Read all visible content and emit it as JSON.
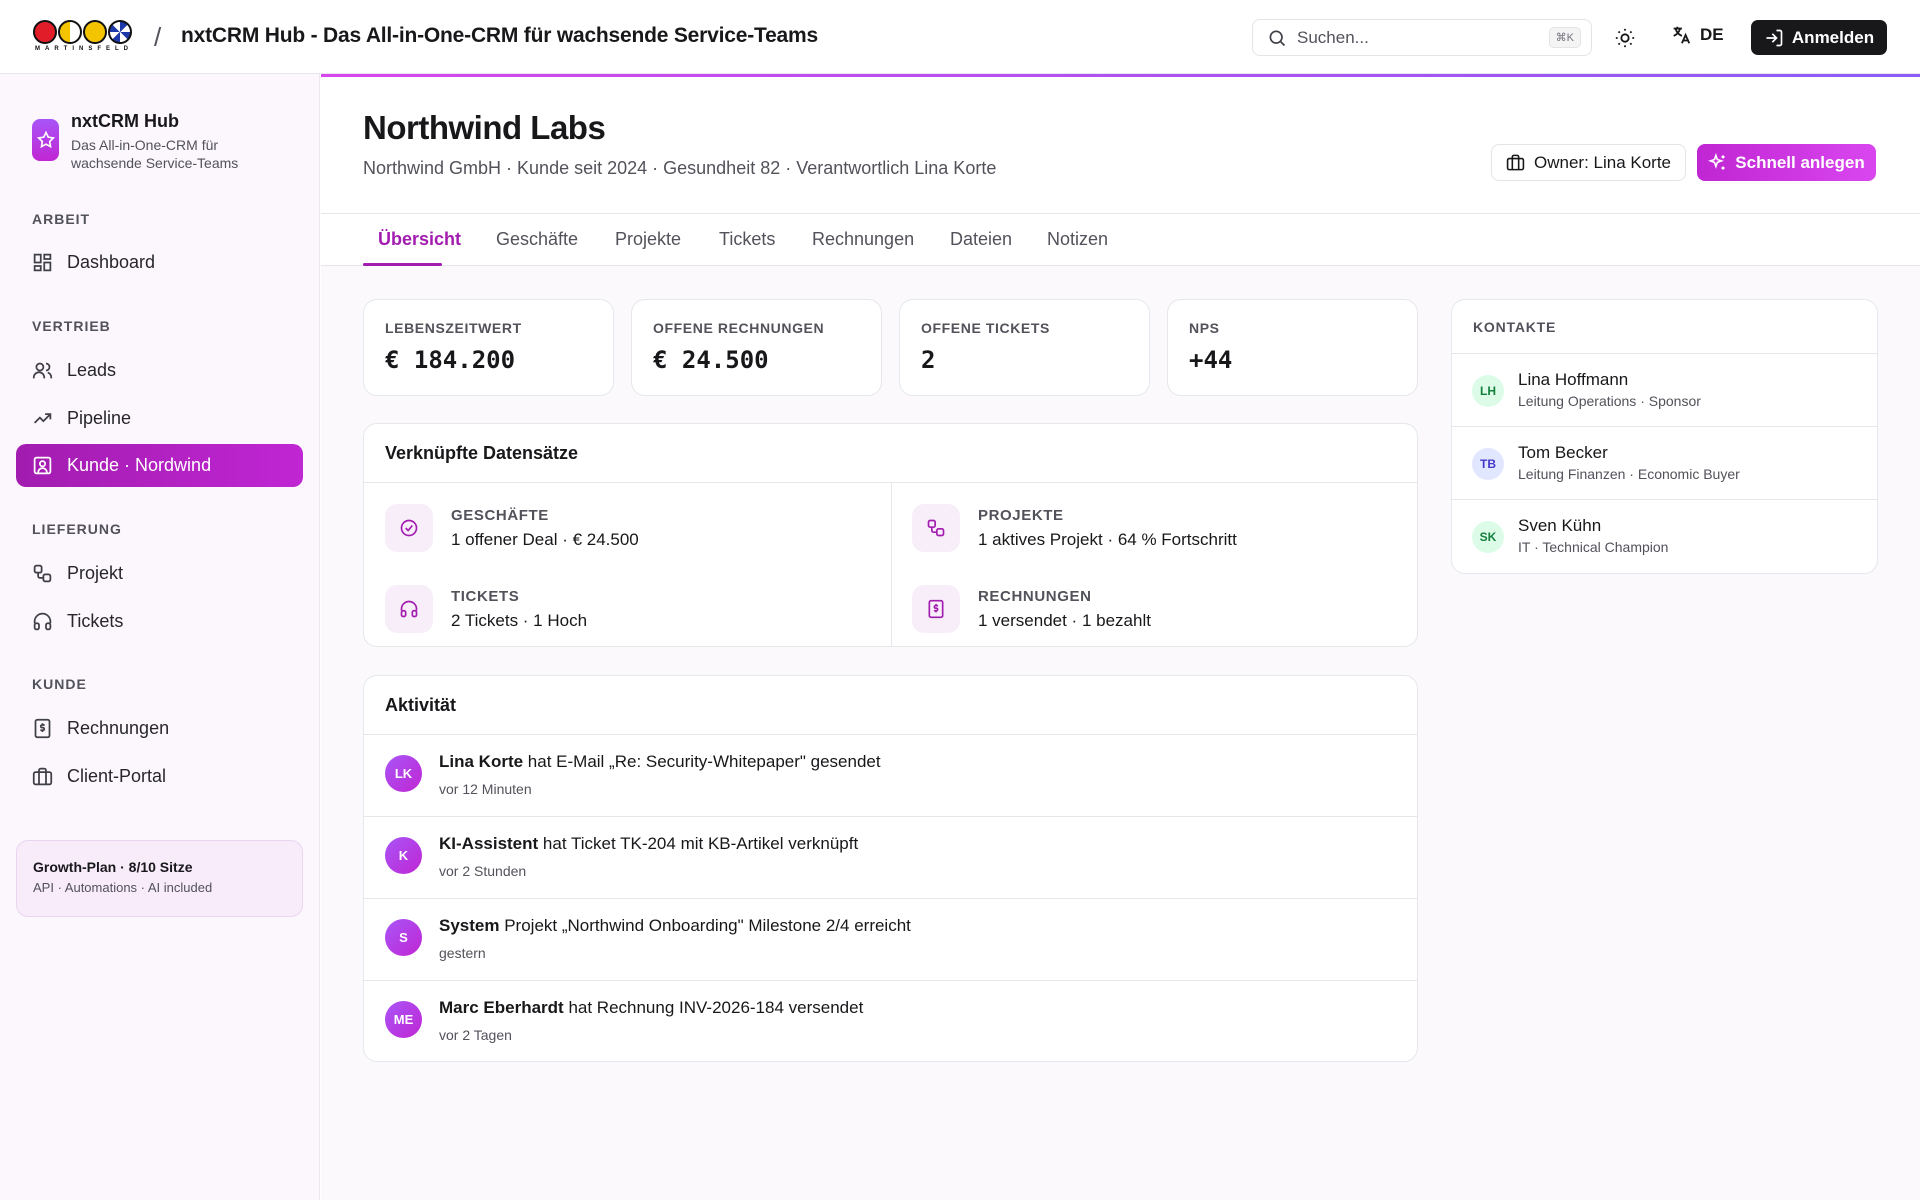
{
  "topbar": {
    "logo_text": "MARTINSFELD",
    "title": "nxtCRM Hub - Das All-in-One-CRM für wachsende Service-Teams",
    "search_placeholder": "Suchen...",
    "search_shortcut": "⌘K",
    "language": "DE",
    "login_label": "Anmelden",
    "icons": [
      "search-icon",
      "sun-icon",
      "translate-icon",
      "login-icon"
    ]
  },
  "sidebar": {
    "brand_name": "nxtCRM Hub",
    "brand_sub": "Das All-in-One-CRM für wachsende Service-Teams",
    "sections": [
      {
        "title": "ARBEIT",
        "items": [
          {
            "label": "Dashboard",
            "icon": "dashboard-icon"
          }
        ]
      },
      {
        "title": "VERTRIEB",
        "items": [
          {
            "label": "Leads",
            "icon": "users-icon"
          },
          {
            "label": "Pipeline",
            "icon": "trending-icon"
          },
          {
            "label": "Kunde · Nordwind",
            "icon": "contact-icon",
            "active": true
          }
        ]
      },
      {
        "title": "LIEFERUNG",
        "items": [
          {
            "label": "Projekt",
            "icon": "workflow-icon"
          },
          {
            "label": "Tickets",
            "icon": "headset-icon"
          }
        ]
      },
      {
        "title": "KUNDE",
        "items": [
          {
            "label": "Rechnungen",
            "icon": "receipt-icon"
          },
          {
            "label": "Client-Portal",
            "icon": "briefcase-icon"
          }
        ]
      }
    ],
    "plan": {
      "title": "Growth-Plan · 8/10 Sitze",
      "sub": "API · Automations · AI included"
    }
  },
  "header": {
    "title": "Northwind Labs",
    "subtitle": "Northwind GmbH · Kunde seit 2024 · Gesundheit 82 · Verantwortlich Lina Korte",
    "owner_label": "Owner: Lina Korte",
    "quick_label": "Schnell anlegen"
  },
  "tabs": [
    "Übersicht",
    "Geschäfte",
    "Projekte",
    "Tickets",
    "Rechnungen",
    "Dateien",
    "Notizen"
  ],
  "kpis": [
    {
      "label": "LEBENSZEITWERT",
      "value": "€ 184.200"
    },
    {
      "label": "OFFENE RECHNUNGEN",
      "value": "€ 24.500"
    },
    {
      "label": "OFFENE TICKETS",
      "value": "2"
    },
    {
      "label": "NPS",
      "value": "+44"
    }
  ],
  "linked": {
    "title": "Verknüpfte Datensätze",
    "items": [
      {
        "label": "GESCHÄFTE",
        "text": "1 offener Deal · € 24.500",
        "icon": "check-circle-icon"
      },
      {
        "label": "PROJEKTE",
        "text": "1 aktives Projekt · 64 % Fortschritt",
        "icon": "workflow-icon"
      },
      {
        "label": "TICKETS",
        "text": "2 Tickets · 1 Hoch",
        "icon": "headset-icon"
      },
      {
        "label": "RECHNUNGEN",
        "text": "1 versendet · 1 bezahlt",
        "icon": "receipt-icon"
      }
    ]
  },
  "activity": {
    "title": "Aktivität",
    "items": [
      {
        "initials": "LK",
        "actor": "Lina Korte",
        "text": "hat E-Mail „Re: Security-Whitepaper\" gesendet",
        "time": "vor 12 Minuten"
      },
      {
        "initials": "K",
        "actor": "KI-Assistent",
        "text": "hat Ticket TK-204 mit KB-Artikel verknüpft",
        "time": "vor 2 Stunden"
      },
      {
        "initials": "S",
        "actor": "System",
        "text": "Projekt „Northwind Onboarding\" Milestone 2/4 erreicht",
        "time": "gestern"
      },
      {
        "initials": "ME",
        "actor": "Marc Eberhardt",
        "text": "hat Rechnung INV-2026-184 versendet",
        "time": "vor 2 Tagen"
      }
    ]
  },
  "contacts": {
    "title": "KONTAKTE",
    "items": [
      {
        "initials": "LH",
        "name": "Lina Hoffmann",
        "role": "Leitung Operations · Sponsor",
        "bg": "#dcfce7",
        "fg": "#15803d"
      },
      {
        "initials": "TB",
        "name": "Tom Becker",
        "role": "Leitung Finanzen · Economic Buyer",
        "bg": "#e0e7ff",
        "fg": "#4338ca"
      },
      {
        "initials": "SK",
        "name": "Sven Kühn",
        "role": "IT · Technical Champion",
        "bg": "#dcfce7",
        "fg": "#15803d"
      }
    ]
  },
  "colors": {
    "accent": "#c026d3",
    "accent_dark": "#a21caf",
    "ink": "#18181b"
  }
}
